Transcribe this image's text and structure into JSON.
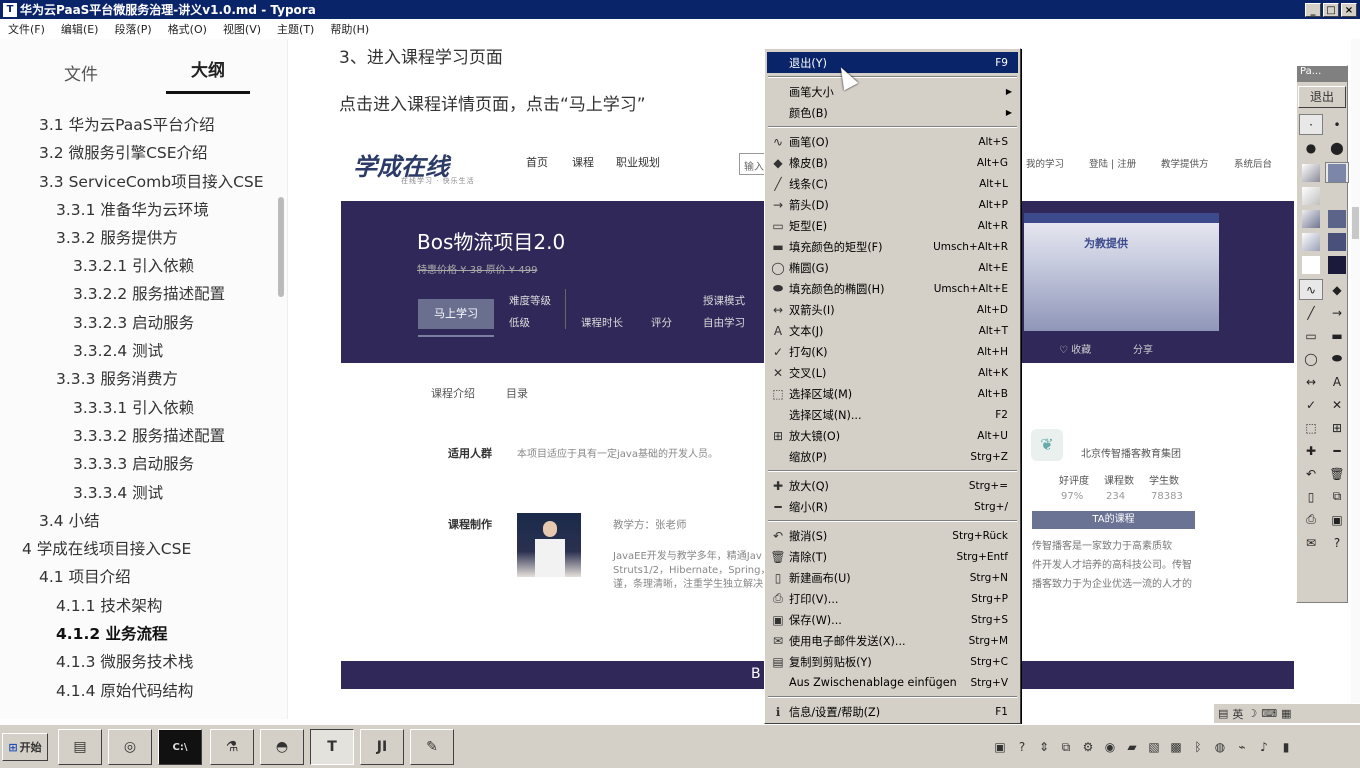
{
  "window": {
    "title": "华为云PaaS平台微服务治理-讲义v1.0.md - Typora",
    "controls": [
      "_",
      "□",
      "×"
    ]
  },
  "menubar": [
    "文件(F)",
    "编辑(E)",
    "段落(P)",
    "格式(O)",
    "视图(V)",
    "主题(T)",
    "帮助(H)"
  ],
  "sidebar": {
    "tab_files": "文件",
    "tab_outline": "大纲",
    "outline": [
      {
        "text": "3.1 华为云PaaS平台介绍",
        "level": 2
      },
      {
        "text": "3.2 微服务引擎CSE介绍",
        "level": 2
      },
      {
        "text": "3.3 ServiceComb项目接入CSE",
        "level": 2
      },
      {
        "text": "3.3.1 准备华为云环境",
        "level": 3
      },
      {
        "text": "3.3.2 服务提供方",
        "level": 3
      },
      {
        "text": "3.3.2.1 引入依赖",
        "level": 4
      },
      {
        "text": "3.3.2.2 服务描述配置",
        "level": 4
      },
      {
        "text": "3.3.2.3 启动服务",
        "level": 4
      },
      {
        "text": "3.3.2.4 测试",
        "level": 4
      },
      {
        "text": "3.3.3 服务消费方",
        "level": 3
      },
      {
        "text": "3.3.3.1 引入依赖",
        "level": 4
      },
      {
        "text": "3.3.3.2 服务描述配置",
        "level": 4
      },
      {
        "text": "3.3.3.3 启动服务",
        "level": 4
      },
      {
        "text": "3.3.3.4 测试",
        "level": 4
      },
      {
        "text": "3.4 小结",
        "level": 2
      },
      {
        "text": "4 学成在线项目接入CSE",
        "level": 1
      },
      {
        "text": "4.1 项目介绍",
        "level": 2
      },
      {
        "text": "4.1.1 技术架构",
        "level": 3
      },
      {
        "text": "4.1.2 业务流程",
        "level": 3,
        "active": true
      },
      {
        "text": "4.1.3 微服务技术栈",
        "level": 3
      },
      {
        "text": "4.1.4 原始代码结构",
        "level": 3
      }
    ],
    "footer_left": "<",
    "footer_right": "</>"
  },
  "doc": {
    "heading": "3、进入课程学习页面",
    "paragraph": "点击进入课程详情页面，点击“马上学习”"
  },
  "embed": {
    "logo": "学成在线",
    "logo_sub": "在线学习 · 快乐生活",
    "nav": [
      "首页",
      "课程",
      "职业规划"
    ],
    "search_placeholder": "输入",
    "nav_right": [
      "我的学习",
      "登陆 | 注册",
      "教学提供方",
      "系统后台"
    ],
    "course_title": "Bos物流项目2.0",
    "price": "特惠价格 ¥ 38  原价 ¥ 499",
    "learn_button": "马上学习",
    "meta_difficulty_label": "难度等级",
    "meta_difficulty_value": "低级",
    "meta_duration": "课程时长",
    "meta_rating": "评分",
    "meta_mode_label": "授课模式",
    "meta_mode_value": "自由学习",
    "hero_image_caption": "为教提供",
    "action_fav": "♡ 收藏",
    "action_share": "分享",
    "tab_intro": "课程介绍",
    "tab_catalog": "目录",
    "audience_label": "适用人群",
    "audience_text": "本项目适应于具有一定java基础的开发人员。",
    "maker_label": "课程制作",
    "teacher": "教学方：张老师",
    "teacher_bio_1": "JavaEE开发与教学多年，精通Jav",
    "teacher_bio_2": "Struts1/2，Hibernate，Spring，M",
    "teacher_bio_3": "谨，条理清晰，注重学生独立解决",
    "org_name": "北京传智播客教育集团",
    "stat_labels": [
      "好评度",
      "课程数",
      "学生数"
    ],
    "stat_values": [
      "97%",
      "234",
      "78383"
    ],
    "org_button": "TA的课程",
    "org_desc_1": "传智播客是一家致力于高素质软",
    "org_desc_2": "件开发人才培养的高科技公司。传智",
    "org_desc_3": "播客致力于为企业优选一流的人才的",
    "footer_char": "B"
  },
  "context_menu": {
    "items": [
      {
        "icon": "",
        "label": "退出(Y)",
        "shortcut": "F9",
        "highlight": true
      },
      {
        "sep": true
      },
      {
        "icon": "",
        "label": "画笔大小",
        "shortcut": "▶",
        "submenu": true
      },
      {
        "icon": "",
        "label": "颜色(B)",
        "shortcut": "▶",
        "submenu": true
      },
      {
        "sep": true
      },
      {
        "icon": "∿",
        "label": "画笔(O)",
        "shortcut": "Alt+S"
      },
      {
        "icon": "◆",
        "label": "橡皮(B)",
        "shortcut": "Alt+G"
      },
      {
        "icon": "╱",
        "label": "线条(C)",
        "shortcut": "Alt+L"
      },
      {
        "icon": "→",
        "label": "箭头(D)",
        "shortcut": "Alt+P"
      },
      {
        "icon": "▭",
        "label": "矩型(E)",
        "shortcut": "Alt+R"
      },
      {
        "icon": "▬",
        "label": "填充颜色的矩型(F)",
        "shortcut": "Umsch+Alt+R"
      },
      {
        "icon": "◯",
        "label": "椭圆(G)",
        "shortcut": "Alt+E"
      },
      {
        "icon": "⬬",
        "label": "填充颜色的椭圆(H)",
        "shortcut": "Umsch+Alt+E"
      },
      {
        "icon": "↔",
        "label": "双箭头(I)",
        "shortcut": "Alt+D"
      },
      {
        "icon": "A",
        "label": "文本(J)",
        "shortcut": "Alt+T"
      },
      {
        "icon": "✓",
        "label": "打勾(K)",
        "shortcut": "Alt+H"
      },
      {
        "icon": "✕",
        "label": "交叉(L)",
        "shortcut": "Alt+K"
      },
      {
        "icon": "⬚",
        "label": "选择区域(M)",
        "shortcut": "Alt+B"
      },
      {
        "icon": "",
        "label": "选择区域(N)...",
        "shortcut": "F2"
      },
      {
        "icon": "⊞",
        "label": "放大镜(O)",
        "shortcut": "Alt+U"
      },
      {
        "icon": "",
        "label": "缩放(P)",
        "shortcut": "Strg+Z"
      },
      {
        "sep": true
      },
      {
        "icon": "✚",
        "label": "放大(Q)",
        "shortcut": "Strg+="
      },
      {
        "icon": "━",
        "label": "缩小(R)",
        "shortcut": "Strg+/"
      },
      {
        "sep": true
      },
      {
        "icon": "↶",
        "label": "撤消(S)",
        "shortcut": "Strg+Rück"
      },
      {
        "icon": "🗑",
        "label": "清除(T)",
        "shortcut": "Strg+Entf"
      },
      {
        "icon": "▯",
        "label": "新建画布(U)",
        "shortcut": "Strg+N"
      },
      {
        "icon": "⎙",
        "label": "打印(V)...",
        "shortcut": "Strg+P"
      },
      {
        "icon": "▣",
        "label": "保存(W)...",
        "shortcut": "Strg+S"
      },
      {
        "icon": "✉",
        "label": "使用电子邮件发送(X)...",
        "shortcut": "Strg+M"
      },
      {
        "icon": "▤",
        "label": "复制到剪贴板(Y)",
        "shortcut": "Strg+C"
      },
      {
        "icon": "",
        "label": "Aus Zwischenablage einfügen",
        "shortcut": "Strg+V"
      },
      {
        "sep": true
      },
      {
        "icon": "ℹ",
        "label": "信息/设置/帮助(Z)",
        "shortcut": "F1"
      }
    ]
  },
  "pen_toolbar": {
    "title": "Pa...",
    "exit_label": "退出"
  },
  "langbar": [
    "英",
    "☽",
    "⌨",
    "▦"
  ],
  "taskbar": {
    "start_label": "开始",
    "tasks": [
      "▤",
      "◎",
      "C:\\",
      "⚗",
      "◓",
      "T",
      "JI",
      "✎"
    ]
  }
}
